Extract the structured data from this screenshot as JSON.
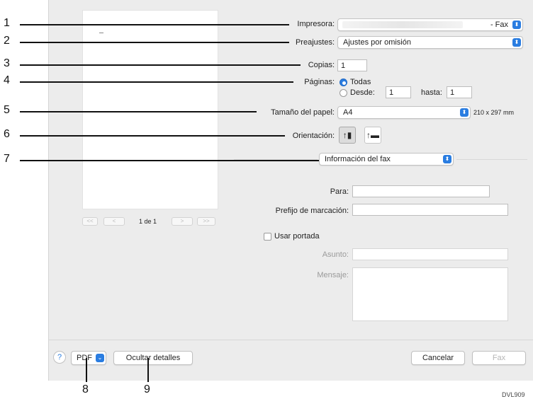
{
  "printer": {
    "label": "Impresora:",
    "value_suffix": "- Fax"
  },
  "presets": {
    "label": "Preajustes:",
    "value": "Ajustes por omisión"
  },
  "copies": {
    "label": "Copias:",
    "value": "1"
  },
  "pages": {
    "label": "Páginas:",
    "all_label": "Todas",
    "from_label": "Desde:",
    "from_value": "1",
    "to_label": "hasta:",
    "to_value": "1"
  },
  "paper": {
    "label": "Tamaño del papel:",
    "value": "A4",
    "dimensions": "210 x 297 mm"
  },
  "orientation": {
    "label": "Orientación:"
  },
  "section_popup": {
    "value": "Información del fax"
  },
  "fax": {
    "to_label": "Para:",
    "dial_prefix_label": "Prefijo de marcación:",
    "use_cover_label": "Usar portada",
    "subject_label": "Asunto:",
    "message_label": "Mensaje:"
  },
  "preview": {
    "page_indicator": "1 de 1",
    "first": "<<",
    "prev": "<",
    "next": ">",
    "last": ">>"
  },
  "footer": {
    "help": "?",
    "pdf": "PDF",
    "hide_details": "Ocultar detalles",
    "cancel": "Cancelar",
    "fax": "Fax"
  },
  "callouts": [
    "1",
    "2",
    "3",
    "4",
    "5",
    "6",
    "7",
    "8",
    "9"
  ],
  "figure_code": "DVL909",
  "colors": {
    "accent": "#2a7de1",
    "dialog_bg": "#ececec"
  }
}
